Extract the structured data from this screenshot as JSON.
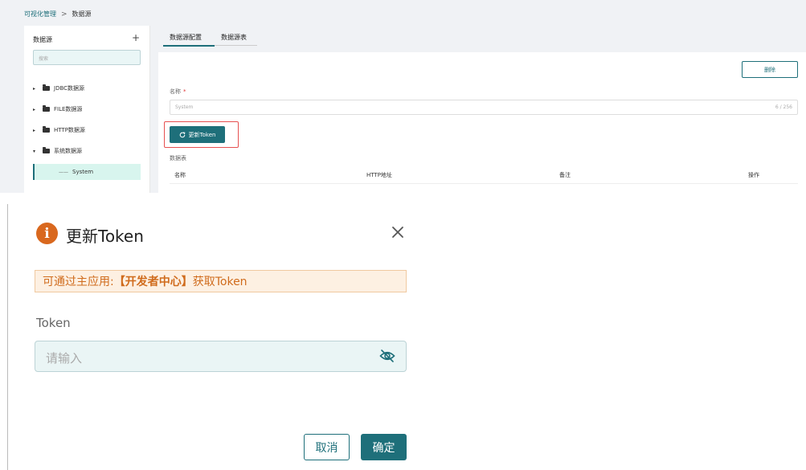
{
  "colors": {
    "accent": "#1e6f7a",
    "warning": "#d9681e",
    "danger_outline": "#e65050"
  },
  "breadcrumb": {
    "parent": "可视化管理",
    "separator": ">",
    "current": "数据源"
  },
  "sidebar": {
    "title": "数据源",
    "add_icon": "plus-icon",
    "search_placeholder": "搜索",
    "items": [
      {
        "label": "JDBC数据源",
        "expanded": false
      },
      {
        "label": "FILE数据源",
        "expanded": false
      },
      {
        "label": "HTTP数据源",
        "expanded": false
      },
      {
        "label": "系统数据源",
        "expanded": true
      }
    ],
    "selected_child": {
      "prefix": "——",
      "label": "System"
    }
  },
  "tabs": [
    {
      "label": "数据源配置",
      "active": true
    },
    {
      "label": "数据源表",
      "active": false
    }
  ],
  "form": {
    "delete_label": "删除",
    "name_label": "名称",
    "required_mark": "*",
    "name_value": "System",
    "name_count": "6 / 256",
    "refresh_icon": "refresh-icon",
    "refresh_label": "更新Token",
    "table_section": "数据表",
    "table_columns": [
      "名称",
      "HTTP地址",
      "备注",
      "操作"
    ]
  },
  "dialog": {
    "icon": "info-icon",
    "title": "更新Token",
    "close_icon": "close-icon",
    "notice_prefix": "可通过主应用:",
    "notice_bold": "【开发者中心】",
    "notice_suffix": "获取Token",
    "token_label": "Token",
    "token_placeholder": "请输入",
    "eye_icon": "eye-off-icon",
    "cancel_label": "取消",
    "ok_label": "确定"
  }
}
